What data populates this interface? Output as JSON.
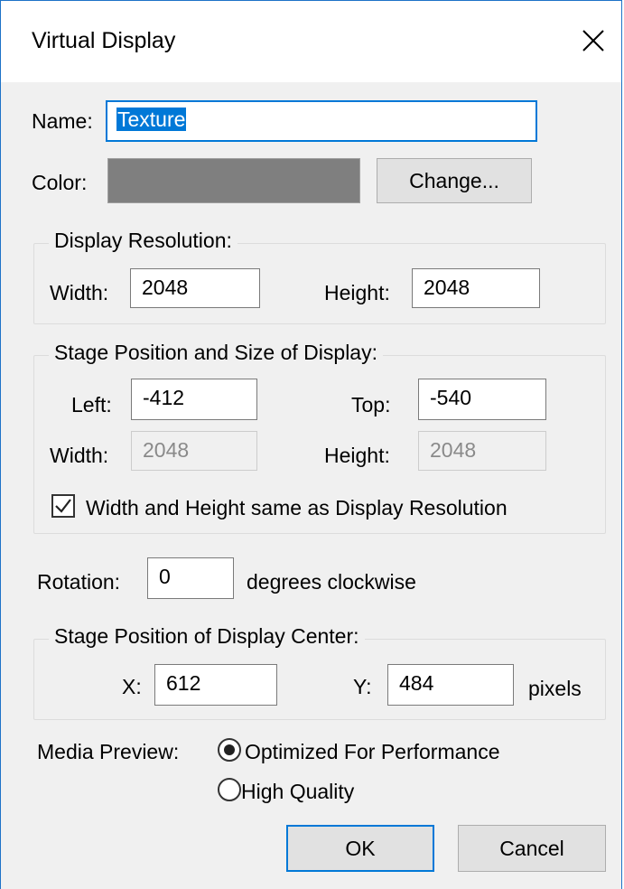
{
  "window": {
    "title": "Virtual Display"
  },
  "name": {
    "label": "Name:",
    "value": "Texture"
  },
  "color": {
    "label": "Color:",
    "swatch": "#7f7f7f",
    "change_label": "Change..."
  },
  "display_resolution": {
    "legend": "Display Resolution:",
    "width_label": "Width:",
    "width_value": "2048",
    "height_label": "Height:",
    "height_value": "2048"
  },
  "stage_position": {
    "legend": "Stage Position and Size of Display:",
    "left_label": "Left:",
    "left_value": "-412",
    "top_label": "Top:",
    "top_value": "-540",
    "width_label": "Width:",
    "width_value": "2048",
    "height_label": "Height:",
    "height_value": "2048",
    "same_checkbox_label": "Width and Height same as Display Resolution",
    "same_checked": true
  },
  "rotation": {
    "label": "Rotation:",
    "value": "0",
    "suffix": "degrees clockwise"
  },
  "display_center": {
    "legend": "Stage Position of Display Center:",
    "x_label": "X:",
    "x_value": "612",
    "y_label": "Y:",
    "y_value": "484",
    "unit": "pixels"
  },
  "media_preview": {
    "label": "Media Preview:",
    "options": [
      {
        "label": "Optimized For Performance",
        "selected": true
      },
      {
        "label": "High Quality",
        "selected": false
      }
    ]
  },
  "buttons": {
    "ok": "OK",
    "cancel": "Cancel"
  },
  "colors": {
    "accent": "#0078d7",
    "window_border": "#1e73c8"
  }
}
